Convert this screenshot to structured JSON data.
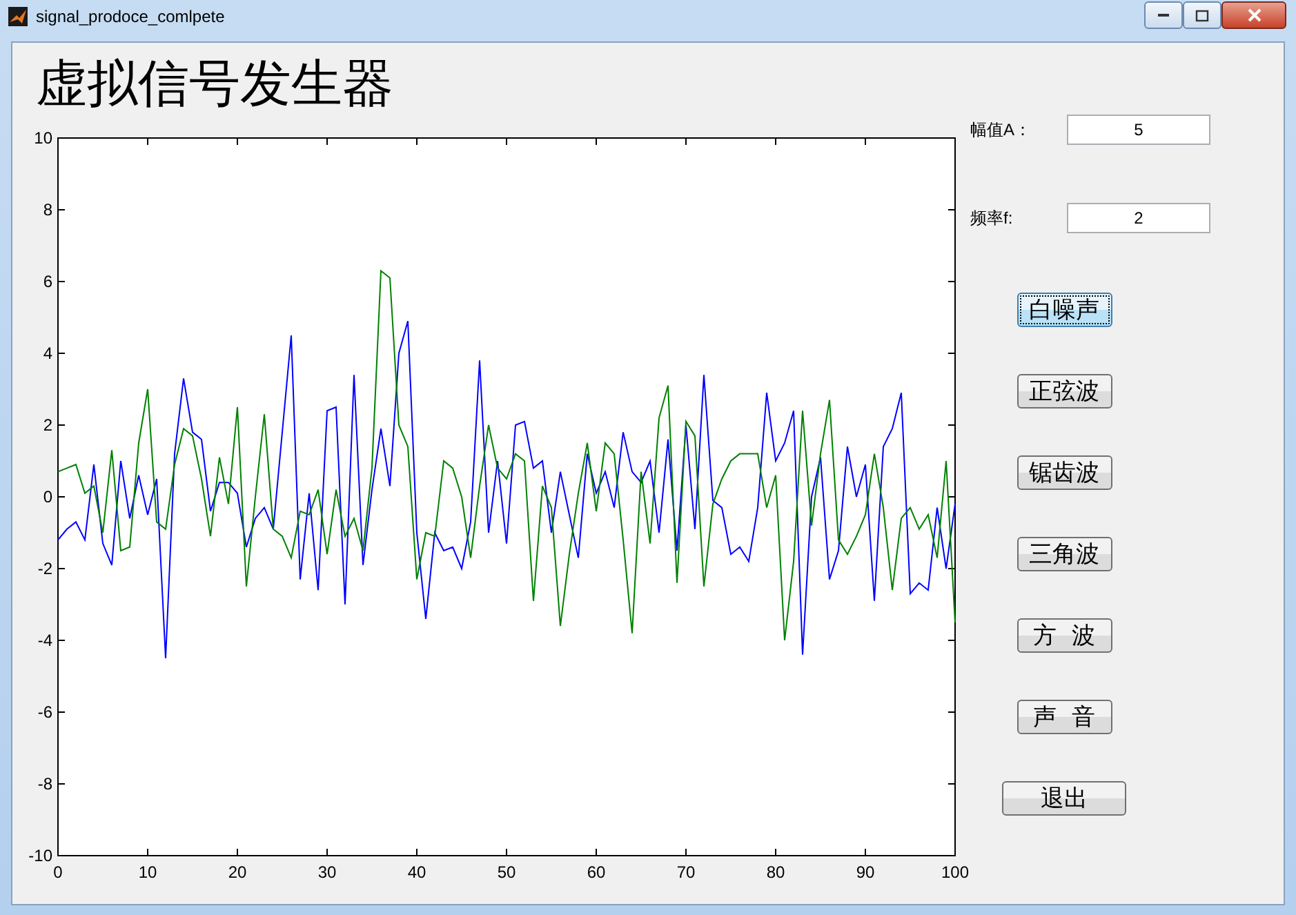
{
  "window": {
    "title": "signal_prodoce_comlpete"
  },
  "heading": "虚拟信号发生器",
  "chart_data": {
    "type": "line",
    "x": [
      0,
      1,
      2,
      3,
      4,
      5,
      6,
      7,
      8,
      9,
      10,
      11,
      12,
      13,
      14,
      15,
      16,
      17,
      18,
      19,
      20,
      21,
      22,
      23,
      24,
      25,
      26,
      27,
      28,
      29,
      30,
      31,
      32,
      33,
      34,
      35,
      36,
      37,
      38,
      39,
      40,
      41,
      42,
      43,
      44,
      45,
      46,
      47,
      48,
      49,
      50,
      51,
      52,
      53,
      54,
      55,
      56,
      57,
      58,
      59,
      60,
      61,
      62,
      63,
      64,
      65,
      66,
      67,
      68,
      69,
      70,
      71,
      72,
      73,
      74,
      75,
      76,
      77,
      78,
      79,
      80,
      81,
      82,
      83,
      84,
      85,
      86,
      87,
      88,
      89,
      90,
      91,
      92,
      93,
      94,
      95,
      96,
      97,
      98,
      99,
      100
    ],
    "xlim": [
      0,
      100
    ],
    "ylim": [
      -10,
      10
    ],
    "xticks": [
      0,
      10,
      20,
      30,
      40,
      50,
      60,
      70,
      80,
      90,
      100
    ],
    "yticks": [
      -10,
      -8,
      -6,
      -4,
      -2,
      0,
      2,
      4,
      6,
      8,
      10
    ],
    "series": [
      {
        "color": "#0000ff",
        "values": [
          -1.2,
          -0.9,
          -0.7,
          -1.2,
          0.9,
          -1.3,
          -1.9,
          1.0,
          -0.6,
          0.6,
          -0.5,
          0.5,
          -4.5,
          1.2,
          3.3,
          1.8,
          1.6,
          -0.4,
          0.4,
          0.4,
          0.1,
          -1.4,
          -0.6,
          -0.3,
          -0.9,
          1.8,
          4.5,
          -2.3,
          0.1,
          -2.6,
          2.4,
          2.5,
          -3.0,
          3.4,
          -1.9,
          0.2,
          1.9,
          0.3,
          4.0,
          4.9,
          -1.0,
          -3.4,
          -1.0,
          -1.5,
          -1.4,
          -2.0,
          -0.7,
          3.8,
          -1.0,
          1.0,
          -1.3,
          2.0,
          2.1,
          0.8,
          1.0,
          -1.0,
          0.7,
          -0.5,
          -1.7,
          1.2,
          0.1,
          0.7,
          -0.3,
          1.8,
          0.7,
          0.4,
          1.0,
          -1.0,
          1.6,
          -1.5,
          2.0,
          -0.9,
          3.4,
          -0.1,
          -0.3,
          -1.6,
          -1.4,
          -1.8,
          -0.3,
          2.9,
          1.0,
          1.5,
          2.4,
          -4.4,
          0.0,
          1.1,
          -2.3,
          -1.5,
          1.4,
          0.0,
          0.9,
          -2.9,
          1.4,
          1.9,
          2.9,
          -2.7,
          -2.4,
          -2.6,
          -0.3,
          -2.0,
          -0.2
        ]
      },
      {
        "color": "#008000",
        "values": [
          0.7,
          0.8,
          0.9,
          0.1,
          0.3,
          -1.0,
          1.3,
          -1.5,
          -1.4,
          1.5,
          3.0,
          -0.7,
          -0.9,
          0.9,
          1.9,
          1.7,
          0.5,
          -1.1,
          1.1,
          -0.2,
          2.5,
          -2.5,
          0.0,
          2.3,
          -0.9,
          -1.1,
          -1.7,
          -0.4,
          -0.5,
          0.2,
          -1.6,
          0.2,
          -1.1,
          -0.6,
          -1.5,
          0.8,
          6.3,
          6.1,
          2.0,
          1.4,
          -2.3,
          -1.0,
          -1.1,
          1.0,
          0.8,
          0.0,
          -1.7,
          0.3,
          2.0,
          0.8,
          0.5,
          1.2,
          1.0,
          -2.9,
          0.3,
          -0.3,
          -3.6,
          -1.6,
          0.1,
          1.5,
          -0.4,
          1.5,
          1.2,
          -1.2,
          -3.8,
          0.7,
          -1.3,
          2.2,
          3.1,
          -2.4,
          2.1,
          1.7,
          -2.5,
          -0.2,
          0.5,
          1.0,
          1.2,
          1.2,
          1.2,
          -0.3,
          0.6,
          -4.0,
          -1.8,
          2.4,
          -0.8,
          1.2,
          2.7,
          -1.2,
          -1.6,
          -1.1,
          -0.5,
          1.2,
          -0.3,
          -2.6,
          -0.6,
          -0.3,
          -0.9,
          -0.5,
          -1.7,
          1.0,
          -3.5
        ]
      }
    ]
  },
  "fields": [
    {
      "label": "幅值A：",
      "value": "5"
    },
    {
      "label": "频率f:",
      "value": "2"
    }
  ],
  "buttons": [
    {
      "label": "白噪声",
      "focused": true,
      "kind": "wave"
    },
    {
      "label": "正弦波",
      "focused": false,
      "kind": "wave"
    },
    {
      "label": "锯齿波",
      "focused": false,
      "kind": "wave"
    },
    {
      "label": "三角波",
      "focused": false,
      "kind": "wave"
    },
    {
      "label": "方  波",
      "focused": false,
      "kind": "wave"
    },
    {
      "label": "声  音",
      "focused": false,
      "kind": "wave"
    },
    {
      "label": "退出",
      "focused": false,
      "kind": "exit"
    }
  ]
}
